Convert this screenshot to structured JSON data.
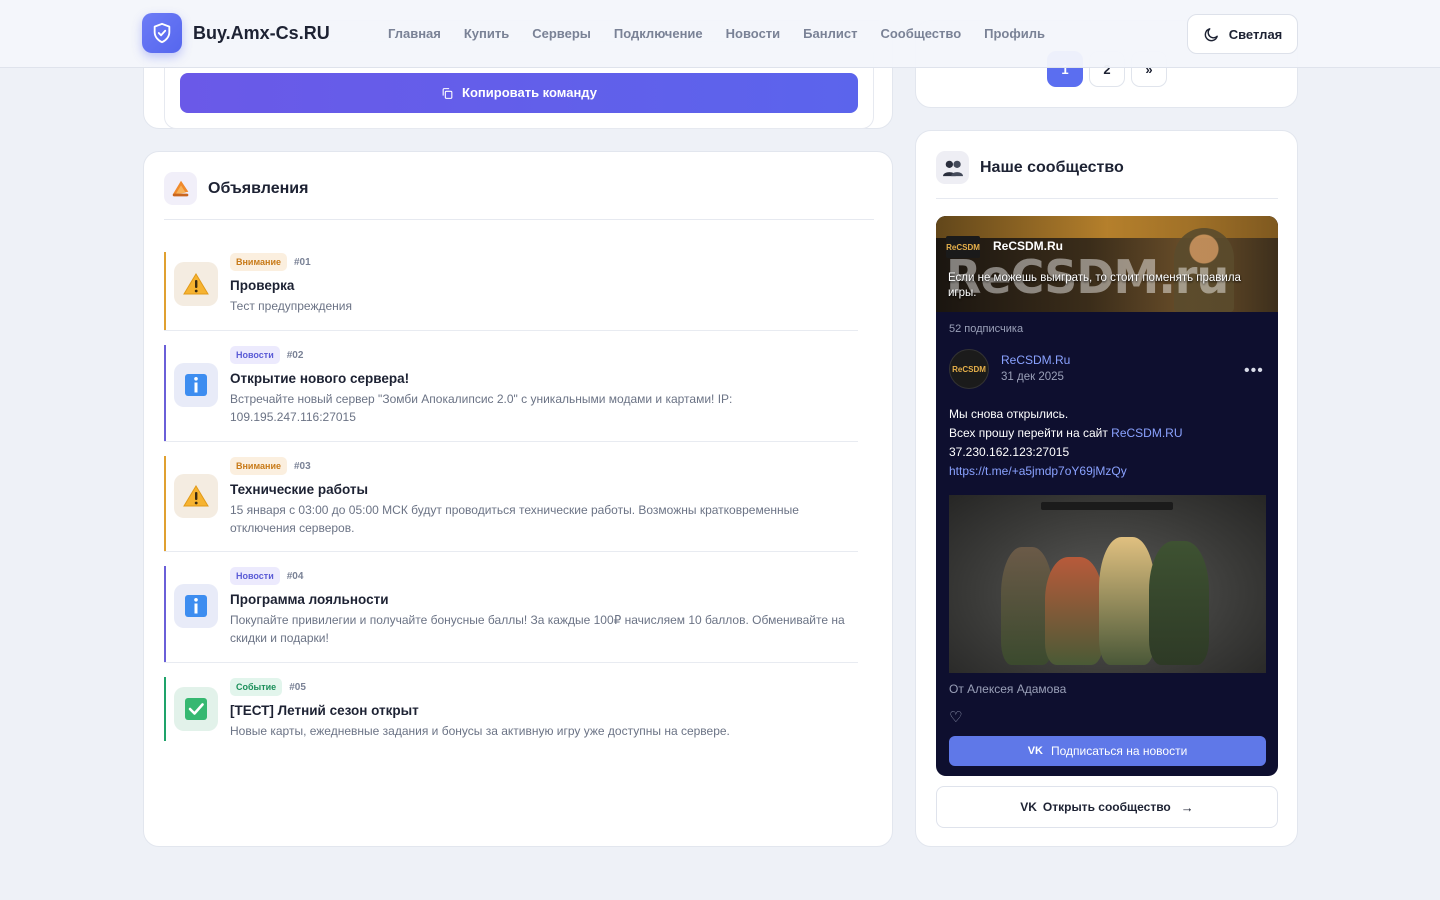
{
  "header": {
    "brand": "Buy.Amx-Cs.RU",
    "nav": [
      "Главная",
      "Купить",
      "Серверы",
      "Подключение",
      "Новости",
      "Банлист",
      "Сообщество",
      "Профиль"
    ],
    "theme_label": "Светлая"
  },
  "connect_card": {
    "copy_button_label": "Копировать команду"
  },
  "pagination": {
    "pages": [
      "1",
      "2"
    ],
    "next": "»",
    "active": "1"
  },
  "announcements": {
    "title": "Объявления",
    "items": [
      {
        "badge": "Внимание",
        "type": "warn",
        "num": "#01",
        "title": "Проверка",
        "text": "Тест предупреждения",
        "icon": "warning-icon"
      },
      {
        "badge": "Новости",
        "type": "news",
        "num": "#02",
        "title": "Открытие нового сервера!",
        "text": "Встречайте новый сервер \"Зомби Апокалипсис 2.0\" с уникальными модами и картами! IP: 109.195.247.116:27015",
        "icon": "info-icon"
      },
      {
        "badge": "Внимание",
        "type": "warn",
        "num": "#03",
        "title": "Технические работы",
        "text": "15 января с 03:00 до 05:00 МСК будут проводиться технические работы. Возможны кратковременные отключения серверов.",
        "icon": "warning-icon"
      },
      {
        "badge": "Новости",
        "type": "news",
        "num": "#04",
        "title": "Программа лояльности",
        "text": "Покупайте привилегии и получайте бонусные баллы! За каждые 100₽ начисляем 10 баллов. Обменивайте на скидки и подарки!",
        "icon": "info-icon"
      },
      {
        "badge": "Событие",
        "type": "event",
        "num": "#05",
        "title": "[ТЕСТ] Летний сезон открыт",
        "text": "Новые карты, ежедневные задания и бонусы за активную игру уже доступны на сервере.",
        "icon": "check-icon"
      }
    ]
  },
  "community": {
    "title": "Наше сообщество",
    "vk": {
      "cover_logo": "ReCSDM",
      "cover_big": "ReCSDM.ru",
      "group_name": "ReCSDM.Ru",
      "slogan": "Если не можешь выиграть, то стоит поменять правила игры.",
      "subscribers": "52 подписчика",
      "avatar_text": "ReCSDM",
      "post_author": "ReCSDM.Ru",
      "post_date": "31 дек 2025",
      "post_line1": "Мы снова открылись.",
      "post_line2_prefix": "Всех прошу перейти на сайт ",
      "post_line2_link": "ReCSDM.RU",
      "post_line3": "37.230.162.123:27015",
      "post_line4": "https://t.me/+a5jmdp7oY69jMzQy",
      "from": "От Алексея Адамова",
      "subscribe_label": "Подписаться на новости",
      "subscribe_vk": "VK"
    },
    "open_vk": "VK",
    "open_label": "Открыть сообщество"
  },
  "colors": {
    "accent": "#5b6ef0",
    "warn": "#e0a030",
    "news": "#6a5fd8",
    "event": "#1ea36a",
    "vk_bg": "#0e0f2f"
  }
}
